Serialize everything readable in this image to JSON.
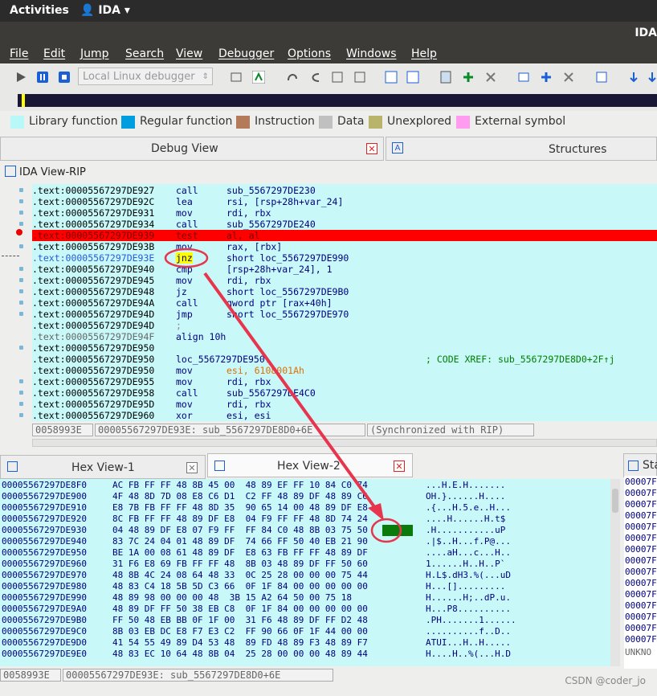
{
  "topbar": {
    "activities": "Activities",
    "app_name": "IDA"
  },
  "window": {
    "title": "IDA"
  },
  "menu": [
    "File",
    "Edit",
    "Jump",
    "Search",
    "View",
    "Debugger",
    "Options",
    "Windows",
    "Help"
  ],
  "toolbar": {
    "debugger_select": "Local Linux debugger"
  },
  "legend": [
    {
      "label": "Library function",
      "color": "#b8f8f8"
    },
    {
      "label": "Regular function",
      "color": "#009ee0"
    },
    {
      "label": "Instruction",
      "color": "#b57a5a"
    },
    {
      "label": "Data",
      "color": "#c0c0c0"
    },
    {
      "label": "Unexplored",
      "color": "#b8b46a"
    },
    {
      "label": "External symbol",
      "color": "#ff9cf0"
    }
  ],
  "tabs": {
    "debug_view": "Debug View",
    "structures": "Structures",
    "hex_view_1": "Hex View-1",
    "hex_view_2": "Hex View-2",
    "sta": "Sta"
  },
  "ida_view": {
    "title": "IDA View-RIP"
  },
  "disasm": [
    {
      "addr": ".text:00005567297DE927",
      "mn": "call",
      "op": "sub_5567297DE230"
    },
    {
      "addr": ".text:00005567297DE92C",
      "mn": "lea",
      "op": "rsi, [rsp+28h+var_24]"
    },
    {
      "addr": ".text:00005567297DE931",
      "mn": "mov",
      "op": "rdi, rbx"
    },
    {
      "addr": ".text:00005567297DE934",
      "mn": "call",
      "op": "sub_5567297DE240"
    },
    {
      "addr": ".text:00005567297DE939",
      "mn": "test",
      "op": "al, al"
    },
    {
      "addr": ".text:00005567297DE93B",
      "mn": "mov",
      "op": "rax, [rbx]"
    },
    {
      "addr": ".text:00005567297DE93E",
      "mn": "jnz",
      "op": "short loc_5567297DE990"
    },
    {
      "addr": ".text:00005567297DE940",
      "mn": "cmp",
      "op": "[rsp+28h+var_24], 1"
    },
    {
      "addr": ".text:00005567297DE945",
      "mn": "mov",
      "op": "rdi, rbx"
    },
    {
      "addr": ".text:00005567297DE948",
      "mn": "jz",
      "op": "short loc_5567297DE9B0"
    },
    {
      "addr": ".text:00005567297DE94A",
      "mn": "call",
      "op": "qword ptr [rax+40h]"
    },
    {
      "addr": ".text:00005567297DE94D",
      "mn": "jmp",
      "op": "short loc_5567297DE970"
    },
    {
      "addr": ".text:00005567297DE94D",
      "mn": ";",
      "op": ""
    },
    {
      "addr": ".text:00005567297DE94F",
      "mn": "align 10h",
      "op": ""
    },
    {
      "addr": ".text:00005567297DE950",
      "mn": "",
      "op": ""
    },
    {
      "addr": ".text:00005567297DE950",
      "mn": "loc_5567297DE950:",
      "op": "",
      "cm": "; CODE XREF: sub_5567297DE8D0+2F↑j"
    },
    {
      "addr": ".text:00005567297DE950",
      "mn": "mov",
      "op": "esi, 6108001Ah"
    },
    {
      "addr": ".text:00005567297DE955",
      "mn": "mov",
      "op": "rdi, rbx"
    },
    {
      "addr": ".text:00005567297DE958",
      "mn": "call",
      "op": "sub_5567297DE4C0"
    },
    {
      "addr": ".text:00005567297DE95D",
      "mn": "mov",
      "op": "rdi, rbx"
    },
    {
      "addr": ".text:00005567297DE960",
      "mn": "xor",
      "op": "esi, esi"
    }
  ],
  "disasm_status": {
    "offset": "0058993E",
    "location": "00005567297DE93E: sub_5567297DE8D0+6E",
    "sync": "(Synchronized with RIP)"
  },
  "hex": [
    {
      "a": "00005567297DE8F0",
      "b": "AC FB FF FF 48 8B 45 00  48 89 EF FF 10 84 C0 74",
      "c": "...H.E.H......."
    },
    {
      "a": "00005567297DE900",
      "b": "4F 48 8D 7D 08 E8 C6 D1  C2 FF 48 89 DF 48 89 C6",
      "c": "OH.}......H...."
    },
    {
      "a": "00005567297DE910",
      "b": "E8 7B FB FF FF 48 8D 35  90 65 14 00 48 89 DF E8",
      "c": ".{...H.5.e..H..."
    },
    {
      "a": "00005567297DE920",
      "b": "8C FB FF FF 48 89 DF E8  04 F9 FF FF 48 8D 74 24",
      "c": "....H......H.t$"
    },
    {
      "a": "00005567297DE930",
      "b": "04 48 89 DF E8 07 F9 FF  FF 84 C0 48 8B 03 75 50",
      "c": ".H...........uP"
    },
    {
      "a": "00005567297DE940",
      "b": "83 7C 24 04 01 48 89 DF  74 66 FF 50 40 EB 21 90",
      "c": ".|$..H...f.P@..."
    },
    {
      "a": "00005567297DE950",
      "b": "BE 1A 00 08 61 48 89 DF  E8 63 FB FF FF 48 89 DF",
      "c": "....aH...c...H.."
    },
    {
      "a": "00005567297DE960",
      "b": "31 F6 E8 69 FB FF FF 48  8B 03 48 89 DF FF 50 60",
      "c": "1......H..H..P`"
    },
    {
      "a": "00005567297DE970",
      "b": "48 8B 4C 24 08 64 48 33  0C 25 28 00 00 00 75 44",
      "c": "H.L$.dH3.%(...uD"
    },
    {
      "a": "00005567297DE980",
      "b": "48 83 C4 18 5B 5D C3 66  0F 1F 84 00 00 00 00 00",
      "c": "H...[]........."
    },
    {
      "a": "00005567297DE990",
      "b": "48 89 98 00 00 00 48  3B 15 A2 64 50 00 75 18",
      "c": "H......H;..dP.u."
    },
    {
      "a": "00005567297DE9A0",
      "b": "48 89 DF FF 50 38 EB C8  0F 1F 84 00 00 00 00 00",
      "c": "H...P8.........."
    },
    {
      "a": "00005567297DE9B0",
      "b": "FF 50 48 EB BB 0F 1F 00  31 F6 48 89 DF FF D2 48",
      "c": ".PH.......1......"
    },
    {
      "a": "00005567297DE9C0",
      "b": "8B 03 EB DC E8 F7 E3 C2  FF 90 66 0F 1F 44 00 00",
      "c": "..........f..D.."
    },
    {
      "a": "00005567297DE9D0",
      "b": "41 54 55 49 89 D4 53 48  89 FD 48 89 F3 48 89 F7",
      "c": "ATUI...H..H....."
    },
    {
      "a": "00005567297DE9E0",
      "b": "48 83 EC 10 64 48 8B 04  25 28 00 00 00 48 89 44",
      "c": "H....H..%(...H.D"
    }
  ],
  "hex_status": {
    "offset": "0058993E",
    "location": "00005567297DE93E: sub_5567297DE8D0+6E"
  },
  "struct_rows": [
    "00007F",
    "00007F",
    "00007F",
    "00007F",
    "00007F",
    "00007F",
    "00007F",
    "00007F",
    "00007F",
    "00007F",
    "00007F",
    "00007F",
    "00007F",
    "00007F",
    "00007F",
    "UNKNO"
  ],
  "watermark": "CSDN @coder_jo"
}
